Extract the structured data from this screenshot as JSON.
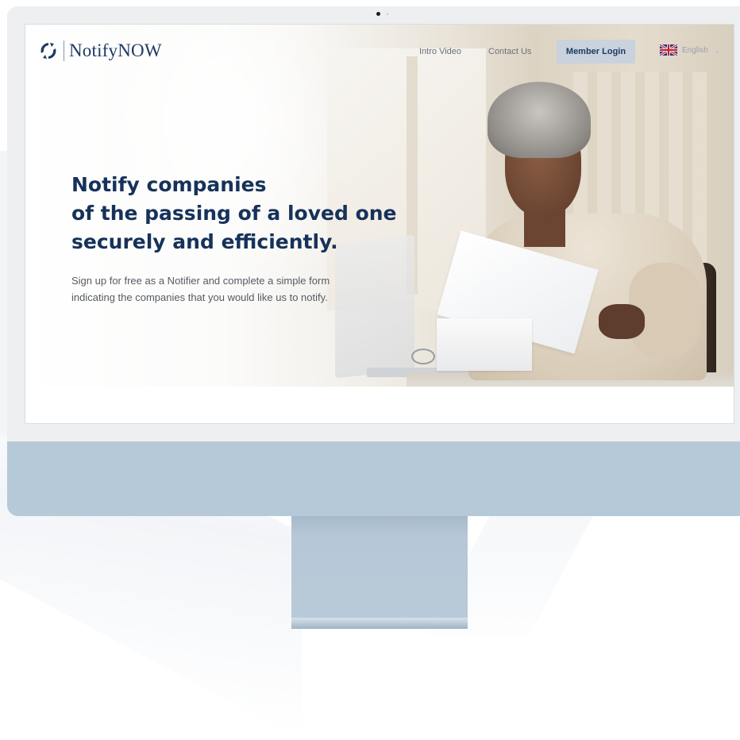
{
  "brand": {
    "name_part1": "Notify",
    "name_part2": "NOW",
    "logo_icon": "circular-arrows-icon"
  },
  "nav": {
    "intro_video": "Intro Video",
    "contact_us": "Contact Us",
    "member_login": "Member Login",
    "language": {
      "label": "English",
      "flag_icon": "uk-flag-icon"
    }
  },
  "hero": {
    "title_lines": [
      "Notify companies",
      "of the passing of a loved one",
      "securely and efficiently."
    ],
    "subtitle_lines": [
      "Sign up for free as a Notifier and complete a simple form",
      "indicating the companies that you would like us to notify."
    ]
  },
  "colors": {
    "brand_navy": "#1e3a63",
    "login_button_bg": "#c9d2dd",
    "monitor_body": "#b9cad9",
    "bezel": "#eeeff0"
  }
}
